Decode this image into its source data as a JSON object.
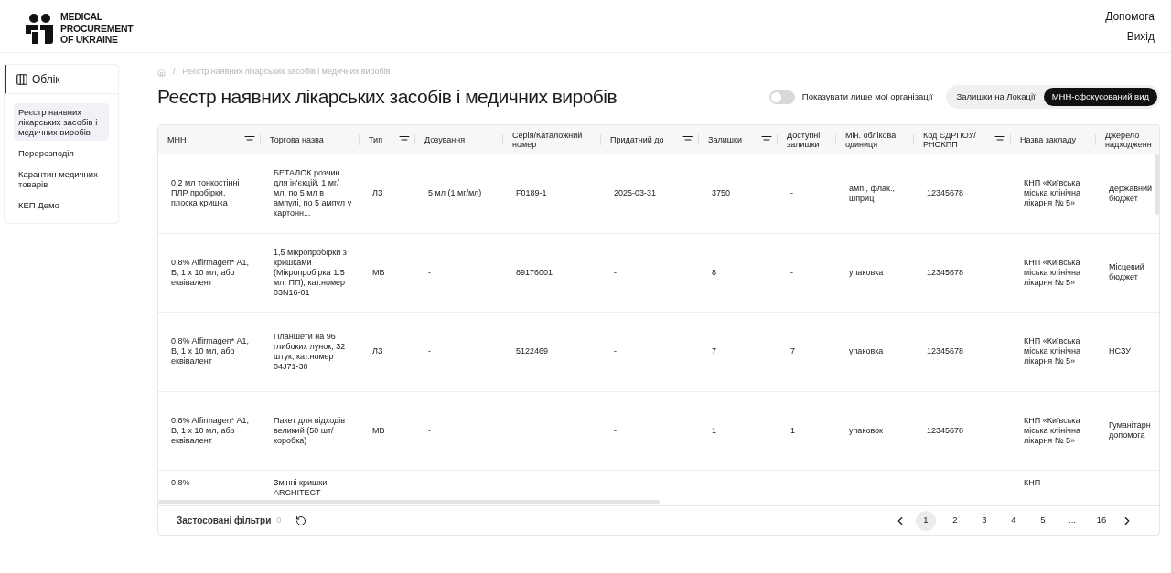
{
  "header": {
    "logo_text": [
      "MEDICAL",
      "PROCUREMENT",
      "OF UKRAINE"
    ],
    "links": [
      "Допомога",
      "Вихід"
    ]
  },
  "sidebar": {
    "section": {
      "label": "Облік",
      "selected": true
    },
    "items": [
      {
        "label": "Реєстр наявних лікарських засобів і медичних виробів",
        "selected": true
      },
      {
        "label": "Перерозподіл",
        "selected": false
      },
      {
        "label": "Карантин медичних товарів",
        "selected": false
      },
      {
        "label": "КЕП Демо",
        "selected": false
      }
    ]
  },
  "breadcrumb_separator": "/",
  "breadcrumb": [
    "Реєстр наявних лікарських засобів і медичних виробів"
  ],
  "title": "Реєстр наявних лікарських засобів і медичних виробів",
  "toggle": {
    "label": "Показувати лише мої організації",
    "on": false
  },
  "view_switch": [
    {
      "label": "Залишки на Локації",
      "selected": false
    },
    {
      "label": "МНН-сфокусований вид",
      "selected": true
    }
  ],
  "table": {
    "columns": [
      {
        "label": "МНН",
        "filter": true
      },
      {
        "label": "Торгова назва",
        "filter": false
      },
      {
        "label": "Тип",
        "filter": true
      },
      {
        "label": "Дозування",
        "filter": false
      },
      {
        "label": "Серія/Каталожний номер",
        "filter": false
      },
      {
        "label": "Придатний до",
        "filter": true
      },
      {
        "label": "Залишки",
        "filter": true
      },
      {
        "label": "Доступні залишки",
        "filter": false
      },
      {
        "label": "Мін. облікова одиниця",
        "filter": false
      },
      {
        "label": "Код ЄДРПОУ/ РНОКПП",
        "filter": true
      },
      {
        "label": "Назва закладу",
        "filter": false
      },
      {
        "label": "Джерело надходженн",
        "filter": false
      }
    ],
    "rows": [
      {
        "cells": [
          "0,2 мл тонкостінні ПЛР пробірки, плоска кришка",
          "БЕТАЛОК розчин для ін'єкцій, 1 мг/ мл, по 5 мл в ампулі, по 5 ампул у картонн...",
          "ЛЗ",
          "5 мл (1 мг/мл)",
          "F0189-1",
          "2025-03-31",
          "3750",
          "-",
          "амп., флак., шприц",
          "12345678",
          "КНП «Київська міська клінічна лікарня № 5»",
          "Державний бюджет"
        ]
      },
      {
        "cells": [
          "0.8% Affirmagen* A1, B, 1 x 10 мл, або еквівалент",
          "1,5 мікропробірки з кришками (Мікропробірка 1.5 мл, ПП), кат.номер 03N16-01",
          "МВ",
          "-",
          "89176001",
          "-",
          "8",
          "-",
          "упаковка",
          "12345678",
          "КНП «Київська міська клінічна лікарня № 5»",
          "Місцевий бюджет"
        ]
      },
      {
        "cells": [
          "0.8% Affirmagen* A1, B, 1 x 10 мл, або еквівалент",
          "Планшети на 96 глибоких лунок, 32 штук, кат.номер 04J71-30",
          "ЛЗ",
          "-",
          "5122469",
          "-",
          "7",
          "7",
          "упаковка",
          "12345678",
          "КНП «Київська міська клінічна лікарня № 5»",
          "НСЗУ"
        ]
      },
      {
        "cells": [
          "0.8% Affirmagen* A1, B, 1 x 10 мл, або еквівалент",
          "Пакет для відходів великий (50 шт/коробка)",
          "МВ",
          "-",
          null,
          "-",
          "1",
          "1",
          "упаковок",
          "12345678",
          "КНП «Київська міська клінічна лікарня № 5»",
          "Гуманітарн допомога"
        ]
      },
      {
        "cells": [
          "0.8%",
          "Змінні кришки ARCHITECT",
          null,
          null,
          null,
          null,
          null,
          null,
          null,
          null,
          "КНП",
          null
        ]
      }
    ]
  },
  "footer": {
    "filters_label": "Застосовані фільтри",
    "filters_count": "0",
    "pages": [
      {
        "label": "1",
        "selected": true
      },
      {
        "label": "2",
        "selected": false
      },
      {
        "label": "3",
        "selected": false
      },
      {
        "label": "4",
        "selected": false
      },
      {
        "label": "5",
        "selected": false
      },
      {
        "label": "...",
        "selected": false
      },
      {
        "label": "16",
        "selected": false
      }
    ]
  }
}
